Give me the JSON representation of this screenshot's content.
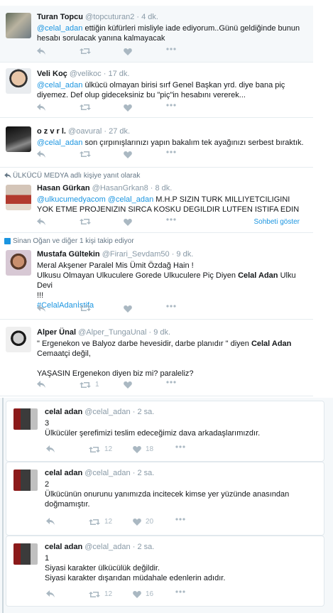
{
  "tweets": [
    {
      "name": "Turan Topcu",
      "handle": "@topcuturan2",
      "time": "4 dk.",
      "mention": "@celal_adan",
      "text": " ettiğin küfürleri misliyle iade ediyorum..Günü geldiğinde bunun hesabı sorulacak yanına kalmayacak"
    },
    {
      "name": "Veli Koç",
      "handle": "@velikoc",
      "time": "17 dk.",
      "mention": "@celal_adan",
      "text": " ülkücü olmayan birisi sırf Genel Başkan yrd. diye bana piç diyemez. Def olup gideceksiniz bu \"piç\"in hesabını vererek..."
    },
    {
      "name": "o z v r l.",
      "handle": "@oavural",
      "time": "27 dk.",
      "mention": "@celal_adan",
      "text": " son çırpınışlarınızı yapın  bakalım tek ayağınızı serbest bıraktık."
    },
    {
      "context": "ÜLKÜCÜ MEDYA adlı kişiye yanıt olarak",
      "name": "Hasan Gürkan",
      "handle": "@HasanGrkan8",
      "time": "8 dk.",
      "mention1": "@ulkucumedyacom",
      "mention2": "@celal_adan",
      "text": " M.H.P SIZIN TURK MILLIYETCILIGINI YOK ETME PROJENIZIN SIRCA KOSKU DEGILDIR LUTFEN ISTIFA EDIN",
      "show_conversation": "Sohbeti göster"
    },
    {
      "context": "Sinan Oğan ve diğer 1 kişi takip ediyor",
      "name": "Mustafa Gültekin",
      "handle": "@Firari_Sevdam50",
      "time": "9 dk.",
      "line1": "Meral Akşener Paralel Mis Ümit Özdağ Hain !",
      "line2a": "Ulkusu Olmayan Ulkuculere Gorede Ulkuculere Piç Diyen ",
      "line2b": "Celal Adan",
      "line2c": " Ulku Devi",
      "line3": "!!!",
      "hashtag": "#CelalAdanİstifa"
    },
    {
      "name": "Alper Ünal",
      "handle": "@Alper_TungaUnal",
      "time": "9 dk.",
      "line1a": "\" Ergenekon ve Balyoz darbe hevesidir, darbe planıdır \" diyen ",
      "line1b": "Celal Adan",
      "line1c": " Cemaatçi değil,",
      "line2": "YAŞASIN Ergenekon diyen biz mi? paraleliz?",
      "retweets": "1"
    }
  ],
  "conversation": [
    {
      "name": "celal adan",
      "handle": "@celal_adan",
      "time": "2 sa.",
      "num": "3",
      "text": "Ülkücüler şerefimizi teslim edeceğimiz dava arkadaşlarımızdır.",
      "retweets": "12",
      "likes": "18"
    },
    {
      "name": "celal adan",
      "handle": "@celal_adan",
      "time": "2 sa.",
      "num": "2",
      "text": "Ülkücünün onurunu yanımızda incitecek kimse yer yüzünde anasından doğmamıştır.",
      "retweets": "12",
      "likes": "20"
    },
    {
      "name": "celal adan",
      "handle": "@celal_adan",
      "time": "2 sa.",
      "num": "1",
      "line1": "Siyasi karakter ülkücülük değildir.",
      "line2": "Siyasi karakter dışarıdan müdahale edenlerin adıdır.",
      "retweets": "12",
      "likes": "16"
    }
  ],
  "colors": {
    "accent": "#1b95e0",
    "muted": "#8899a6",
    "icon": "#aab8c2",
    "border": "#e6ecf0"
  }
}
